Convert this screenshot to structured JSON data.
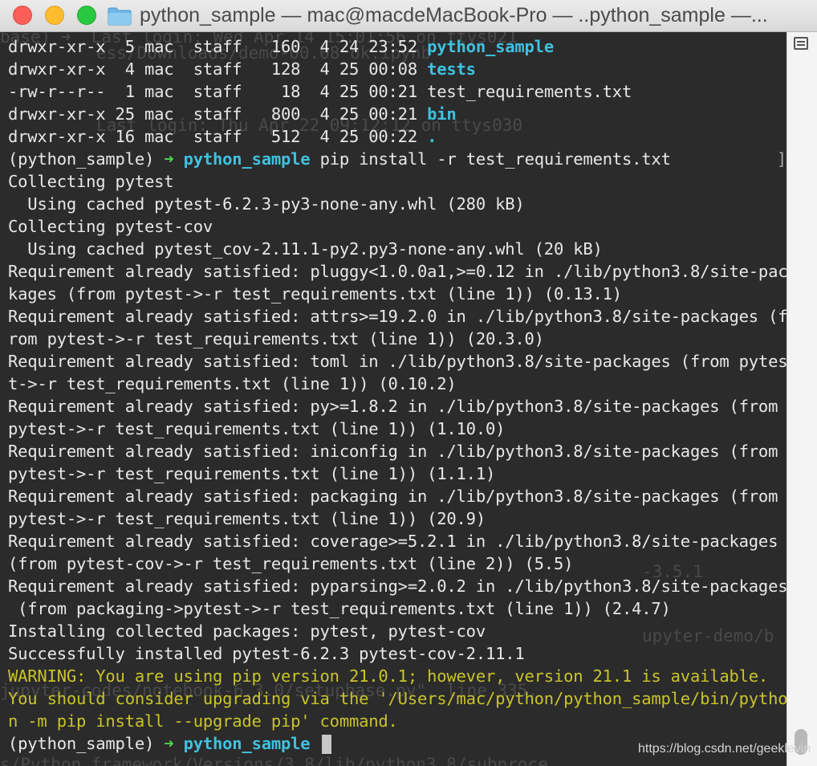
{
  "window": {
    "title": "python_sample — mac@macdeMacBook-Pro — ..python_sample —..."
  },
  "terminal": {
    "listing": [
      {
        "perms": "drwxr-xr-x",
        "links": " 5",
        "owner": "mac",
        "group": "staff",
        "size": "160",
        "date": "4 24 23:52",
        "name": "python_sample",
        "is_dir": true
      },
      {
        "perms": "drwxr-xr-x",
        "links": " 4",
        "owner": "mac",
        "group": "staff",
        "size": "128",
        "date": "4 25 00:08",
        "name": "tests",
        "is_dir": true
      },
      {
        "perms": "-rw-r--r--",
        "links": " 1",
        "owner": "mac",
        "group": "staff",
        "size": " 18",
        "date": "4 25 00:21",
        "name": "test_requirements.txt",
        "is_dir": false
      },
      {
        "perms": "drwxr-xr-x",
        "links": "25",
        "owner": "mac",
        "group": "staff",
        "size": "800",
        "date": "4 25 00:21",
        "name": "bin",
        "is_dir": true
      },
      {
        "perms": "drwxr-xr-x",
        "links": "16",
        "owner": "mac",
        "group": "staff",
        "size": "512",
        "date": "4 25 00:22",
        "name": ".",
        "is_dir": true
      }
    ],
    "prompt_env": "(python_sample)",
    "prompt_arrow": "➜",
    "prompt_dir": "python_sample",
    "command": "pip install -r test_requirements.txt",
    "output": [
      "Collecting pytest",
      "  Using cached pytest-6.2.3-py3-none-any.whl (280 kB)",
      "Collecting pytest-cov",
      "  Using cached pytest_cov-2.11.1-py2.py3-none-any.whl (20 kB)",
      "Requirement already satisfied: pluggy<1.0.0a1,>=0.12 in ./lib/python3.8/site-pac",
      "kages (from pytest->-r test_requirements.txt (line 1)) (0.13.1)",
      "Requirement already satisfied: attrs>=19.2.0 in ./lib/python3.8/site-packages (f",
      "rom pytest->-r test_requirements.txt (line 1)) (20.3.0)",
      "Requirement already satisfied: toml in ./lib/python3.8/site-packages (from pytes",
      "t->-r test_requirements.txt (line 1)) (0.10.2)",
      "Requirement already satisfied: py>=1.8.2 in ./lib/python3.8/site-packages (from",
      "pytest->-r test_requirements.txt (line 1)) (1.10.0)",
      "Requirement already satisfied: iniconfig in ./lib/python3.8/site-packages (from",
      "pytest->-r test_requirements.txt (line 1)) (1.1.1)",
      "Requirement already satisfied: packaging in ./lib/python3.8/site-packages (from",
      "pytest->-r test_requirements.txt (line 1)) (20.9)",
      "Requirement already satisfied: coverage>=5.2.1 in ./lib/python3.8/site-packages",
      "(from pytest-cov->-r test_requirements.txt (line 2)) (5.5)",
      "Requirement already satisfied: pyparsing>=2.0.2 in ./lib/python3.8/site-packages",
      " (from packaging->pytest->-r test_requirements.txt (line 1)) (2.4.7)",
      "Installing collected packages: pytest, pytest-cov",
      "Successfully installed pytest-6.2.3 pytest-cov-2.11.1"
    ],
    "warning": [
      "WARNING: You are using pip version 21.0.1; however, version 21.1 is available.",
      "You should consider upgrading via the '/Users/mac/python/python_sample/bin/pytho",
      "n -m pip install --upgrade pip' command."
    ],
    "colors": {
      "background": "#2b2b2b",
      "directory": "#3fc1e0",
      "warning": "#c9c42a",
      "arrow": "#4cd64c"
    }
  },
  "watermark": "https://blog.csdn.net/geeklevin"
}
